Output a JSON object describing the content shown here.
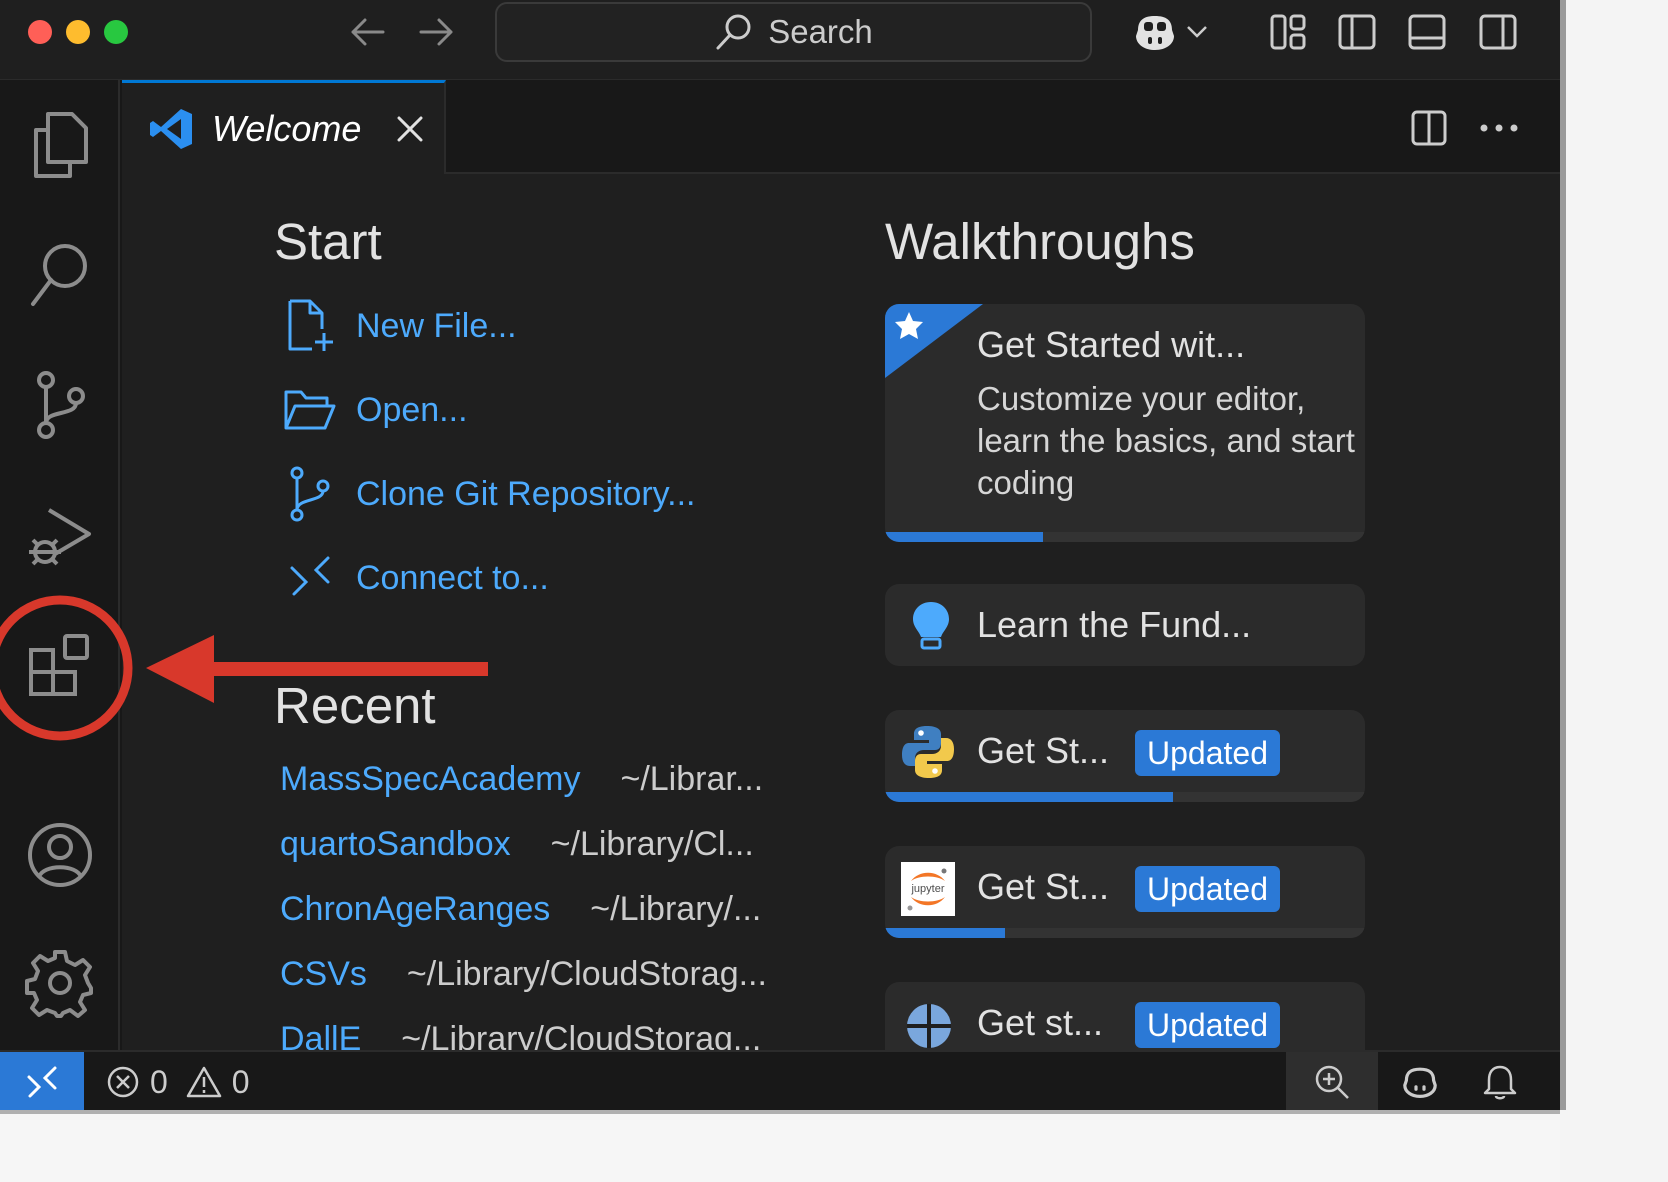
{
  "titlebar": {
    "search_label": "Search"
  },
  "tabs": [
    {
      "label": "Welcome"
    }
  ],
  "welcome": {
    "start_heading": "Start",
    "start_items": [
      {
        "label": "New File...",
        "icon": "new-file-icon"
      },
      {
        "label": "Open...",
        "icon": "folder-open-icon"
      },
      {
        "label": "Clone Git Repository...",
        "icon": "git-branch-icon"
      },
      {
        "label": "Connect to...",
        "icon": "remote-icon"
      }
    ],
    "recent_heading": "Recent",
    "recent_items": [
      {
        "name": "MassSpecAcademy",
        "path": "~/Librar..."
      },
      {
        "name": "quartoSandbox",
        "path": "~/Library/Cl..."
      },
      {
        "name": "ChronAgeRanges",
        "path": "~/Library/..."
      },
      {
        "name": "CSVs",
        "path": "~/Library/CloudStorag..."
      },
      {
        "name": "DallE",
        "path": "~/Library/CloudStorag..."
      }
    ],
    "walkthroughs_heading": "Walkthroughs",
    "walkthroughs": [
      {
        "title": "Get Started wit...",
        "description": "Customize your editor, learn the basics, and start coding",
        "progress": 0.33,
        "icon": "star-icon"
      },
      {
        "title": "Learn the Fund...",
        "icon": "lightbulb-icon"
      },
      {
        "title": "Get St...",
        "badge": "Updated",
        "progress": 0.6,
        "icon": "python-icon"
      },
      {
        "title": "Get St...",
        "badge": "Updated",
        "progress": 0.25,
        "icon": "jupyter-icon",
        "icon_text": "jupyter"
      },
      {
        "title": "Get st...",
        "badge": "Updated",
        "icon": "globe-icon"
      }
    ]
  },
  "statusbar": {
    "errors": "0",
    "warnings": "0"
  },
  "colors": {
    "accent": "#2b79d6",
    "link": "#4daafc",
    "annotation": "#d8382b"
  }
}
